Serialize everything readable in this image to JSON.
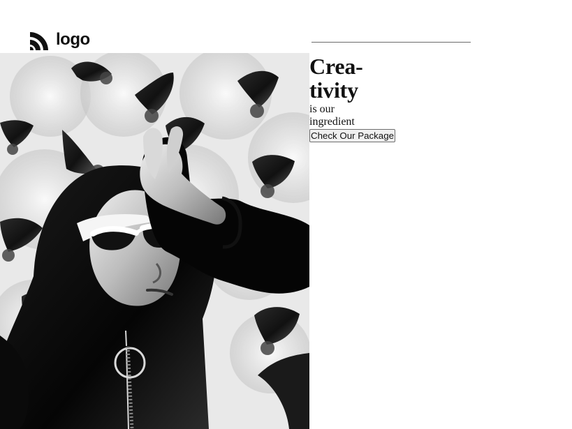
{
  "header": {
    "logo_text": "logo",
    "logo_icon": "rss-stripes-icon"
  },
  "hero": {
    "headline_lines": [
      "Crea-",
      "tivity"
    ],
    "tagline_lines": [
      "is our",
      "ingredient"
    ],
    "cta_label": "Check Our Package",
    "image_subject": "black-and-white portrait"
  },
  "colors": {
    "background": "#ffffff",
    "text": "#111111",
    "rule": "#6b6b6b",
    "button_bg": "#f0f0f0",
    "button_border": "#6e6e6e"
  }
}
